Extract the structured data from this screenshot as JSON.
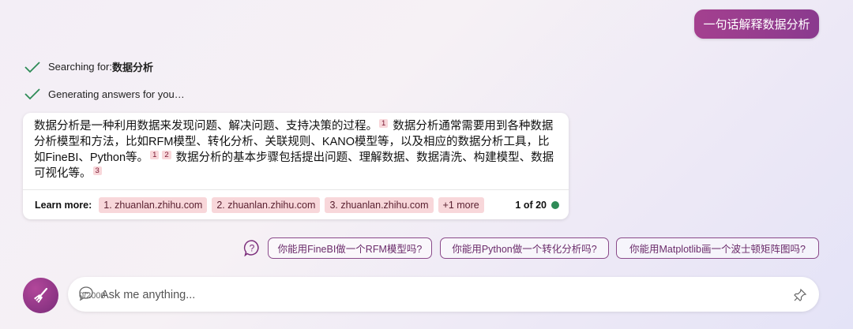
{
  "user_message": "一句话解释数据分析",
  "status": {
    "searching_prefix": "Searching for: ",
    "searching_term": "数据分析",
    "generating": "Generating answers for you…"
  },
  "answer": {
    "p1": "数据分析是一种利用数据来发现问题、解决问题、支持决策的过程。",
    "c1": "1",
    "p2": " 数据分析通常需要用到各种数据分析模型和方法，比如RFM模型、转化分析、关联规则、KANO模型等，以及相应的数据分析工具，比如FineBI、Python等。",
    "c2a": "1",
    "c2b": "2",
    "p3": " 数据分析的基本步骤包括提出问题、理解数据、数据清洗、构建模型、数据可视化等。",
    "c3": "3"
  },
  "learn_more": {
    "label": "Learn more:",
    "sources": [
      "1. zhuanlan.zhihu.com",
      "2. zhuanlan.zhihu.com",
      "3. zhuanlan.zhihu.com"
    ],
    "more": "+1 more",
    "counter": "1 of 20"
  },
  "suggestions": [
    "你能用FineBI做一个RFM模型吗?",
    "你能用Python做一个转化分析吗?",
    "你能用Matplotlib画一个波士顿矩阵图吗?"
  ],
  "input": {
    "placeholder": "Ask me anything...",
    "char_count": "0/2000"
  },
  "icons": {
    "status": "check-icon",
    "suggestions": "question-bubble-icon",
    "new_topic": "broom-icon",
    "input": "chat-bubble-icon",
    "pin": "pin-icon"
  },
  "colors": {
    "accent": "#8a3a8e",
    "check": "#2e8b57",
    "citation_bg": "#f8d7da"
  }
}
